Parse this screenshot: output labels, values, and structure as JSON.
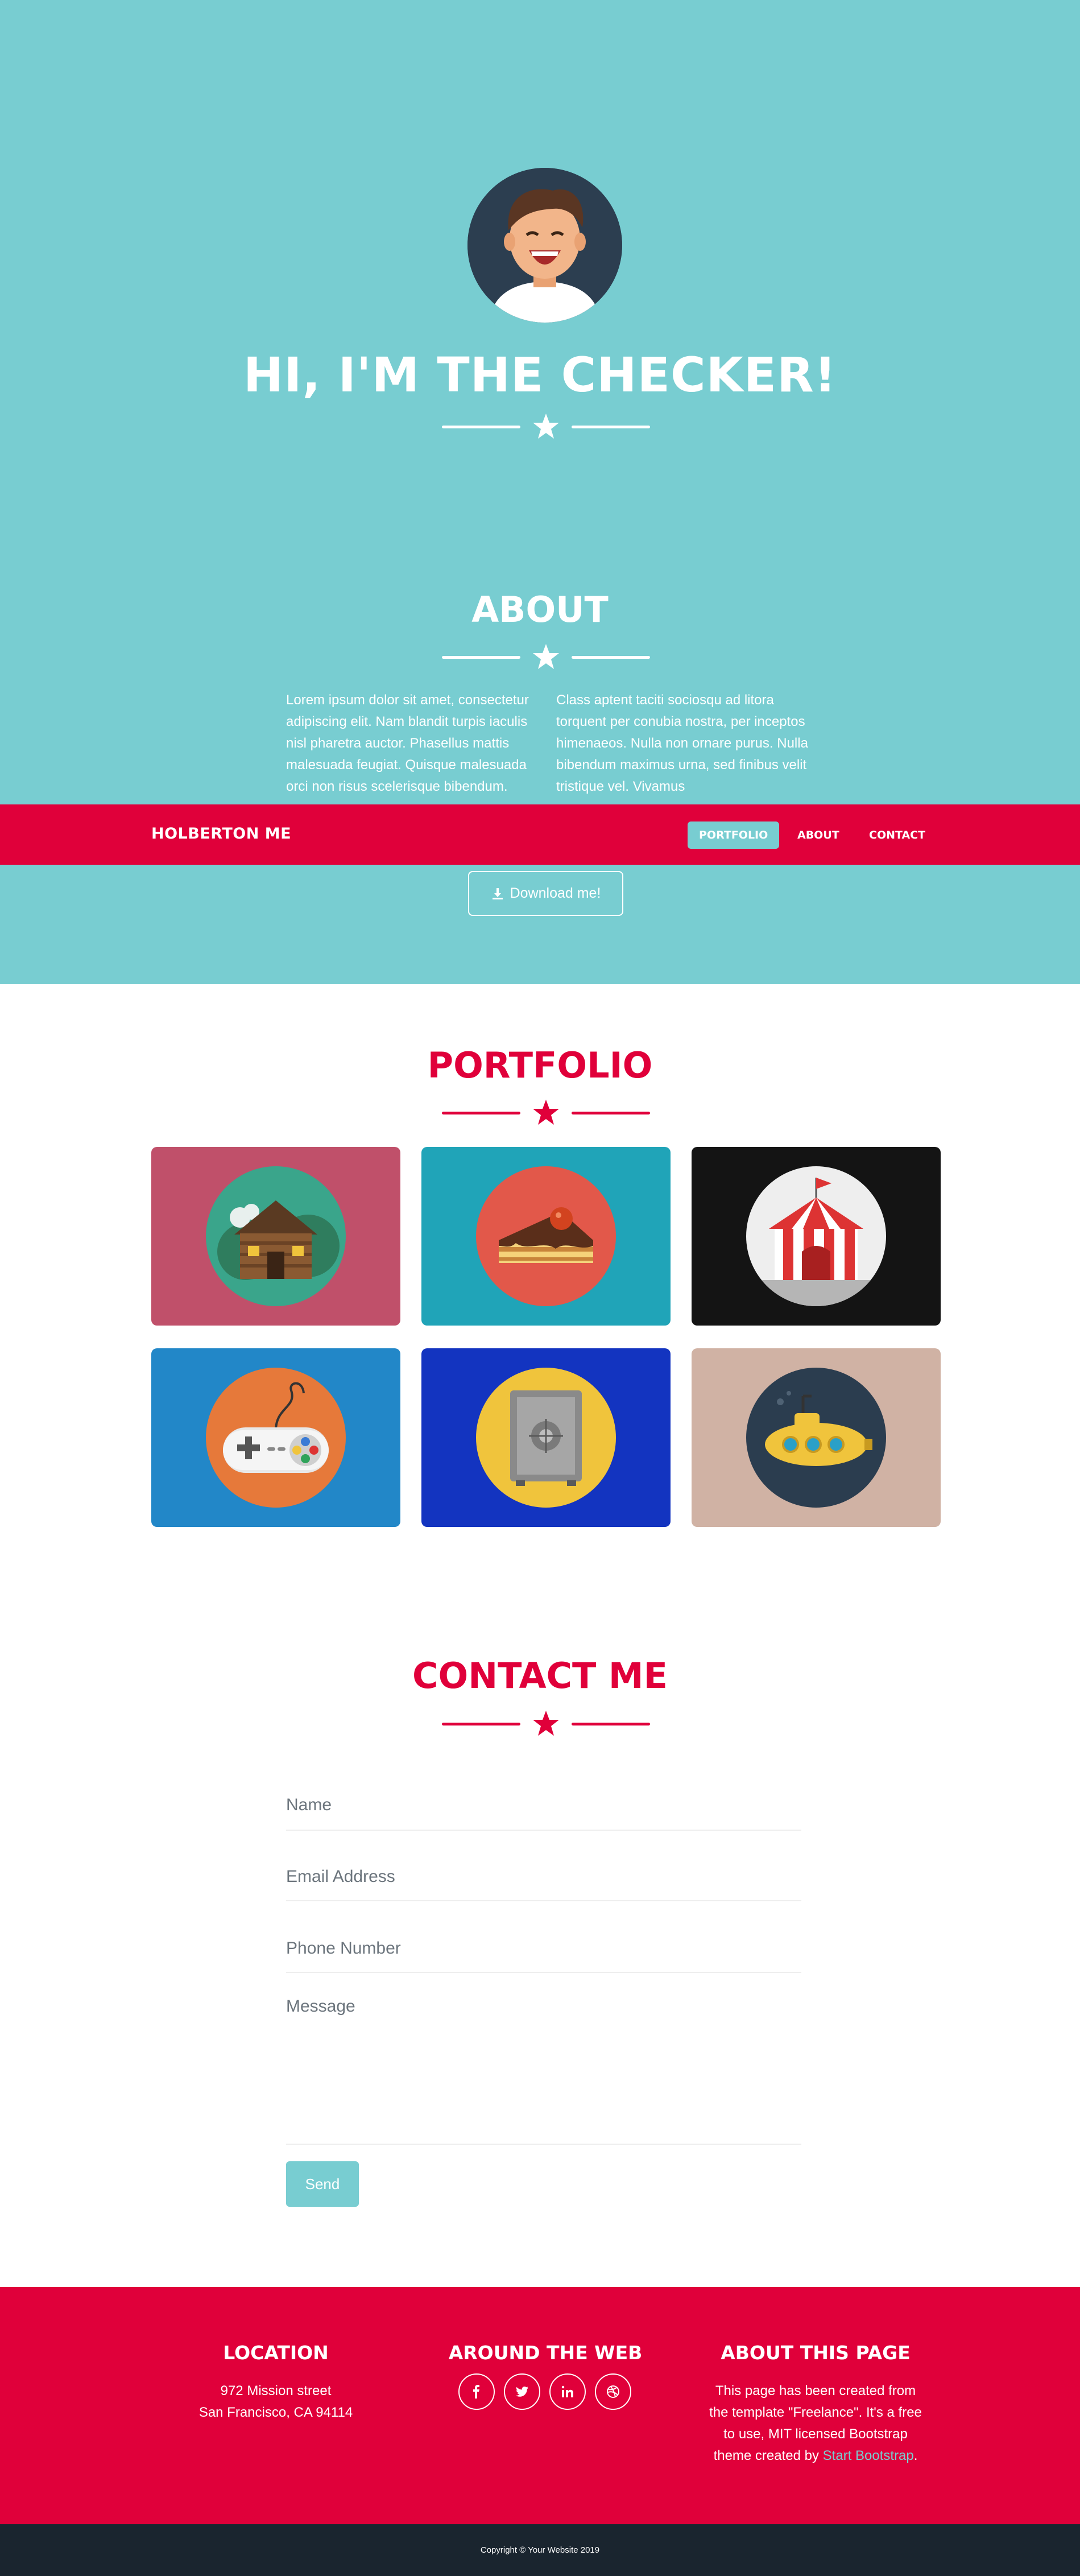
{
  "hero": {
    "title": "HI, I'M THE CHECKER!"
  },
  "about": {
    "title": "ABOUT",
    "left_text": "Lorem ipsum dolor sit amet, consectetur adipiscing elit. Nam blandit turpis iaculis nisl pharetra auctor. Phasellus mattis malesuada feugiat. Quisque malesuada orci non risus scelerisque bibendum.",
    "right_text": "Class aptent taciti sociosqu ad litora torquent per conubia nostra, per inceptos himenaeos. Nulla non ornare purus. Nulla bibendum maximus urna, sed finibus velit tristique vel. Vivamus",
    "download_label": "Download me!"
  },
  "nav": {
    "brand": "HOLBERTON ME",
    "items": [
      {
        "label": "PORTFOLIO"
      },
      {
        "label": "ABOUT"
      },
      {
        "label": "CONTACT"
      }
    ]
  },
  "portfolio": {
    "title": "PORTFOLIO",
    "items": [
      {
        "icon": "cabin-icon",
        "bg": "#c0506a",
        "circle": "#3aa58b"
      },
      {
        "icon": "cake-icon",
        "bg": "#20a4b8",
        "circle": "#e2584a"
      },
      {
        "icon": "circus-tent-icon",
        "bg": "#141414",
        "circle": "#eeeeee"
      },
      {
        "icon": "game-controller-icon",
        "bg": "#2287c8",
        "circle": "#e6793a"
      },
      {
        "icon": "safe-icon",
        "bg": "#1334c0",
        "circle": "#f0c43c"
      },
      {
        "icon": "submarine-icon",
        "bg": "#d0b2a4",
        "circle": "#2b3d4f"
      }
    ]
  },
  "contact": {
    "title": "CONTACT ME",
    "name_placeholder": "Name",
    "email_placeholder": "Email Address",
    "phone_placeholder": "Phone Number",
    "message_placeholder": "Message",
    "send_label": "Send"
  },
  "footer": {
    "location_title": "LOCATION",
    "address_line1": "972 Mission street",
    "address_line2": "San Francisco, CA 94114",
    "web_title": "AROUND THE WEB",
    "social": [
      "facebook-icon",
      "twitter-icon",
      "linkedin-icon",
      "dribbble-icon"
    ],
    "about_title": "ABOUT THIS PAGE",
    "about_text": "This page has been created from the template \"Freelance\". It's a free to use, MIT licensed Bootstrap theme created by",
    "about_link": "Start Bootstrap",
    "about_end": "."
  },
  "copyright": "Copyright © Your Website 2019",
  "colors": {
    "primary": "#78cdd1",
    "accent": "#e0003a",
    "dark": "#1a252f"
  }
}
